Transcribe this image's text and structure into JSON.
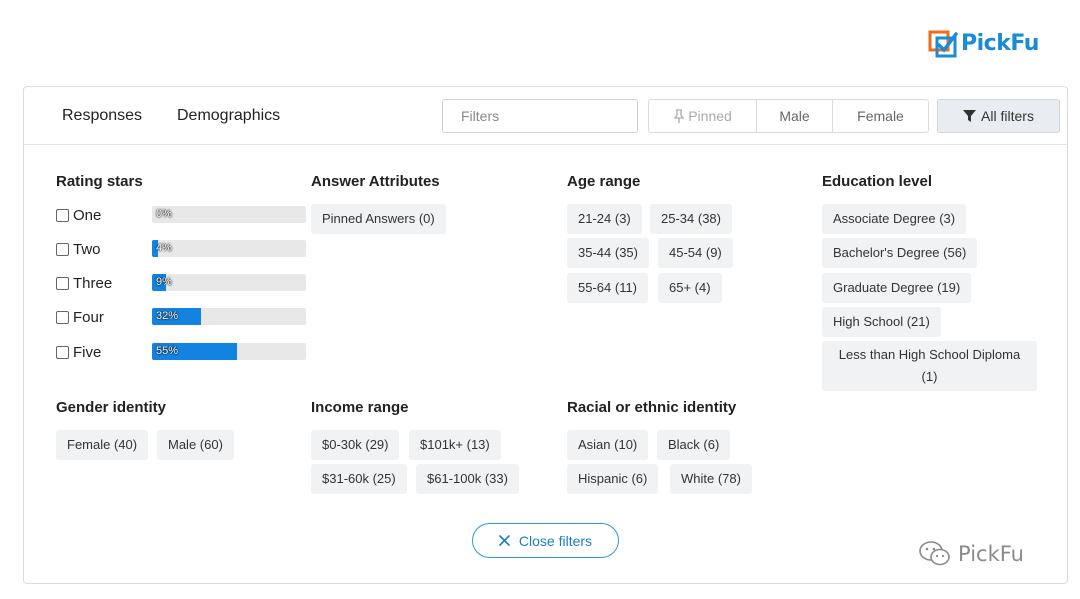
{
  "brand": {
    "logo_text": "PickFu",
    "watermark_text": "PickFu"
  },
  "tabs": [
    {
      "label": "Responses"
    },
    {
      "label": "Demographics"
    }
  ],
  "filters": {
    "placeholder": "Filters"
  },
  "quick_filters": [
    {
      "label": "Pinned"
    },
    {
      "label": "Male"
    },
    {
      "label": "Female"
    }
  ],
  "all_filters_label": "All filters",
  "rating": {
    "title": "Rating stars",
    "rows": [
      {
        "label": "One",
        "percent": 0,
        "text": "0%"
      },
      {
        "label": "Two",
        "percent": 4,
        "text": "4%"
      },
      {
        "label": "Three",
        "percent": 9,
        "text": "9%"
      },
      {
        "label": "Four",
        "percent": 32,
        "text": "32%"
      },
      {
        "label": "Five",
        "percent": 55,
        "text": "55%"
      }
    ]
  },
  "answer_attributes": {
    "title": "Answer Attributes",
    "chips": [
      "Pinned Answers (0)"
    ]
  },
  "age_range": {
    "title": "Age range",
    "chips": [
      "21-24 (3)",
      "25-34 (38)",
      "35-44 (35)",
      "45-54 (9)",
      "55-64 (11)",
      "65+ (4)"
    ]
  },
  "education": {
    "title": "Education level",
    "chips": [
      "Associate Degree (3)",
      "Bachelor's Degree (56)",
      "Graduate Degree (19)",
      "High School (21)",
      "Less than High School Diploma (1)"
    ]
  },
  "gender": {
    "title": "Gender identity",
    "chips": [
      "Female (40)",
      "Male (60)"
    ]
  },
  "income": {
    "title": "Income range",
    "chips": [
      "$0-30k (29)",
      "$101k+ (13)",
      "$31-60k (25)",
      "$61-100k (33)"
    ]
  },
  "racial": {
    "title": "Racial or ethnic identity",
    "chips": [
      "Asian (10)",
      "Black (6)",
      "Hispanic (6)",
      "White (78)"
    ]
  },
  "close_filters_label": "Close filters"
}
